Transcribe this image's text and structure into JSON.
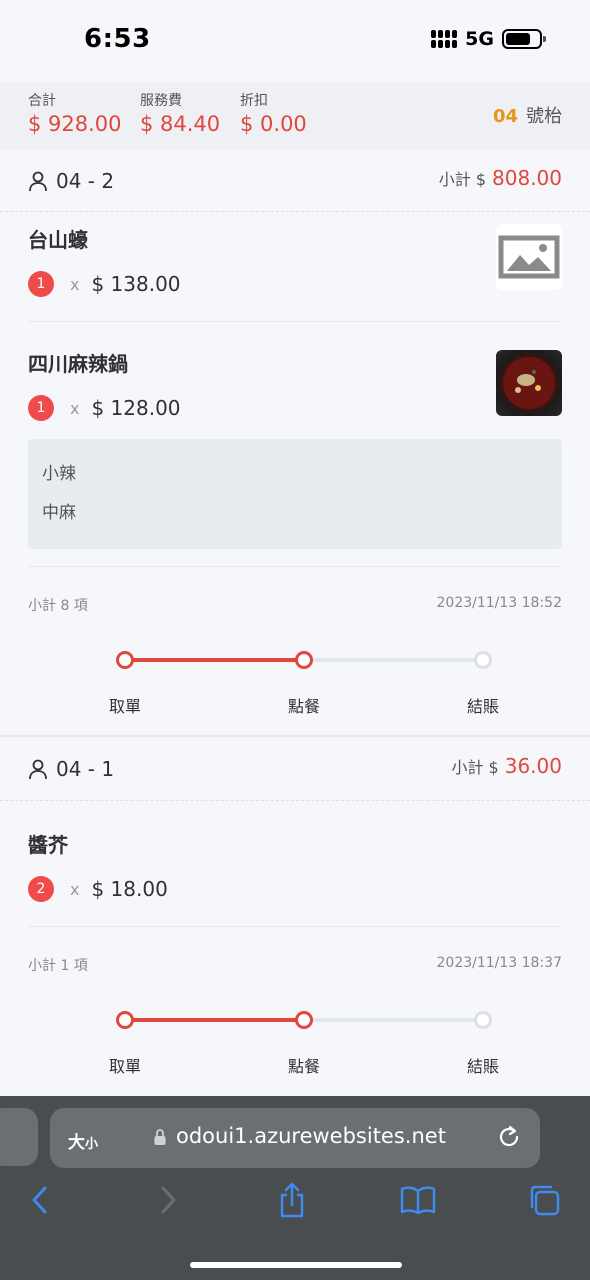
{
  "status_bar": {
    "time": "6:53",
    "network": "5G"
  },
  "summary": {
    "total_label": "合計",
    "total_value": "$ 928.00",
    "service_label": "服務費",
    "service_value": "$ 84.40",
    "discount_label": "折扣",
    "discount_value": "$ 0.00",
    "table_number": "04",
    "table_label": "號枱"
  },
  "orders": [
    {
      "id": "04 - 2",
      "subtotal_label": "小計 $",
      "subtotal_value": "808.00",
      "dishes": [
        {
          "name": "台山蠔",
          "qty": "1",
          "times": "x",
          "price": "$ 138.00",
          "thumb": "image-placeholder-icon"
        },
        {
          "name": "四川麻辣鍋",
          "qty": "1",
          "times": "x",
          "price": "$ 128.00",
          "thumb": "hotpot-photo",
          "notes": [
            "小辣",
            "中麻"
          ]
        }
      ],
      "item_count": "小計 8 項",
      "timestamp": "2023/11/13 18:52",
      "steps": [
        "取單",
        "點餐",
        "結賬"
      ],
      "progress_completed_steps": 2
    },
    {
      "id": "04 - 1",
      "subtotal_label": "小計 $",
      "subtotal_value": "36.00",
      "dishes": [
        {
          "name": "醬芥",
          "qty": "2",
          "times": "x",
          "price": "$ 18.00"
        }
      ],
      "item_count": "小計 1 項",
      "timestamp": "2023/11/13 18:37",
      "steps": [
        "取單",
        "點餐",
        "結賬"
      ],
      "progress_completed_steps": 2
    }
  ],
  "browser": {
    "text_size_big": "大",
    "text_size_small": "小",
    "url": "odoui1.azurewebsites.net",
    "accent_color": "#3d8cf0"
  }
}
